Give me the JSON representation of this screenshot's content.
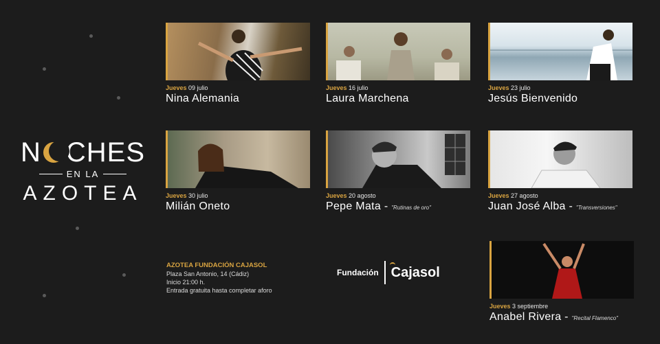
{
  "logo": {
    "line1_a": "N",
    "line1_b": "CHES",
    "line2": "EN LA",
    "line3": "AZOTEA"
  },
  "events": [
    {
      "day": "Jueves",
      "date": "09 julio",
      "name": "Nina Alemania",
      "subtitle": ""
    },
    {
      "day": "Jueves",
      "date": "16 julio",
      "name": "Laura Marchena",
      "subtitle": ""
    },
    {
      "day": "Jueves",
      "date": "23 julio",
      "name": "Jesús Bienvenido",
      "subtitle": ""
    },
    {
      "day": "Jueves",
      "date": "30 julio",
      "name": "Milián Oneto",
      "subtitle": ""
    },
    {
      "day": "Jueves",
      "date": "20 agosto",
      "name": "Pepe Mata",
      "subtitle": "\"Rutinas de oro\""
    },
    {
      "day": "Jueves",
      "date": "27 agosto",
      "name": "Juan José Alba",
      "subtitle": "\"Transversiones\""
    },
    {
      "day": "Jueves",
      "date": "3 septiembre",
      "name": "Anabel Rivera",
      "subtitle": "\"Recital Flamenco\""
    }
  ],
  "venue": {
    "title": "AZOTEA FUNDACIÓN CAJASOL",
    "address": "Plaza San Antonio, 14 (Cádiz)",
    "time": "Inicio 21:00 h.",
    "entry": "Entrada gratuita hasta completar aforo"
  },
  "sponsor": {
    "label": "Fundación",
    "brand": "Cajasol"
  },
  "colors": {
    "background": "#1c1c1c",
    "accent": "#d9a441"
  }
}
